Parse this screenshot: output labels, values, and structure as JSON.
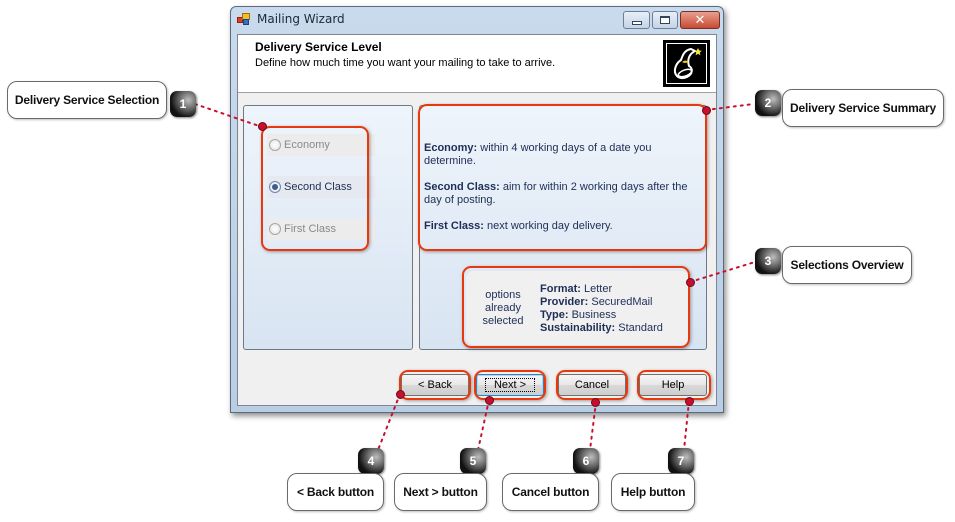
{
  "window": {
    "title": "Mailing Wizard",
    "controls": {
      "minimize": "minimize",
      "maximize": "maximize",
      "close": "✕"
    }
  },
  "header": {
    "title": "Delivery Service Level",
    "subtitle": "Define how much time you want your mailing to take to arrive.",
    "icon": "wizard-hat-icon"
  },
  "delivery_options": [
    {
      "label": "Economy",
      "checked": false,
      "enabled": false
    },
    {
      "label": "Second Class",
      "checked": true,
      "enabled": true
    },
    {
      "label": "First Class",
      "checked": false,
      "enabled": false
    }
  ],
  "summary": [
    {
      "term": "Economy:",
      "text": " within 4 working days of a date you determine."
    },
    {
      "term": "Second Class:",
      "text": " aim for within 2 working days after the day of posting."
    },
    {
      "term": "First Class:",
      "text": " next working day delivery."
    }
  ],
  "overview": {
    "note": "options already selected",
    "items": [
      {
        "term": "Format:",
        "value": " Letter"
      },
      {
        "term": "Provider:",
        "value": " SecuredMail"
      },
      {
        "term": "Type:",
        "value": " Business"
      },
      {
        "term": "Sustainability:",
        "value": " Standard"
      }
    ]
  },
  "buttons": {
    "back": "< Back",
    "next": "Next >",
    "cancel": "Cancel",
    "help": "Help"
  },
  "callouts": [
    {
      "number": "1",
      "label": "Delivery Service Selection"
    },
    {
      "number": "2",
      "label": "Delivery Service Summary"
    },
    {
      "number": "3",
      "label": "Selections Overview"
    },
    {
      "number": "4",
      "label": "< Back button"
    },
    {
      "number": "5",
      "label": "Next > button"
    },
    {
      "number": "6",
      "label": "Cancel button"
    },
    {
      "number": "7",
      "label": "Help button"
    }
  ],
  "colors": {
    "highlight": "#e8380c",
    "pin": "#c8102e",
    "text_blue": "#1e2e55"
  }
}
